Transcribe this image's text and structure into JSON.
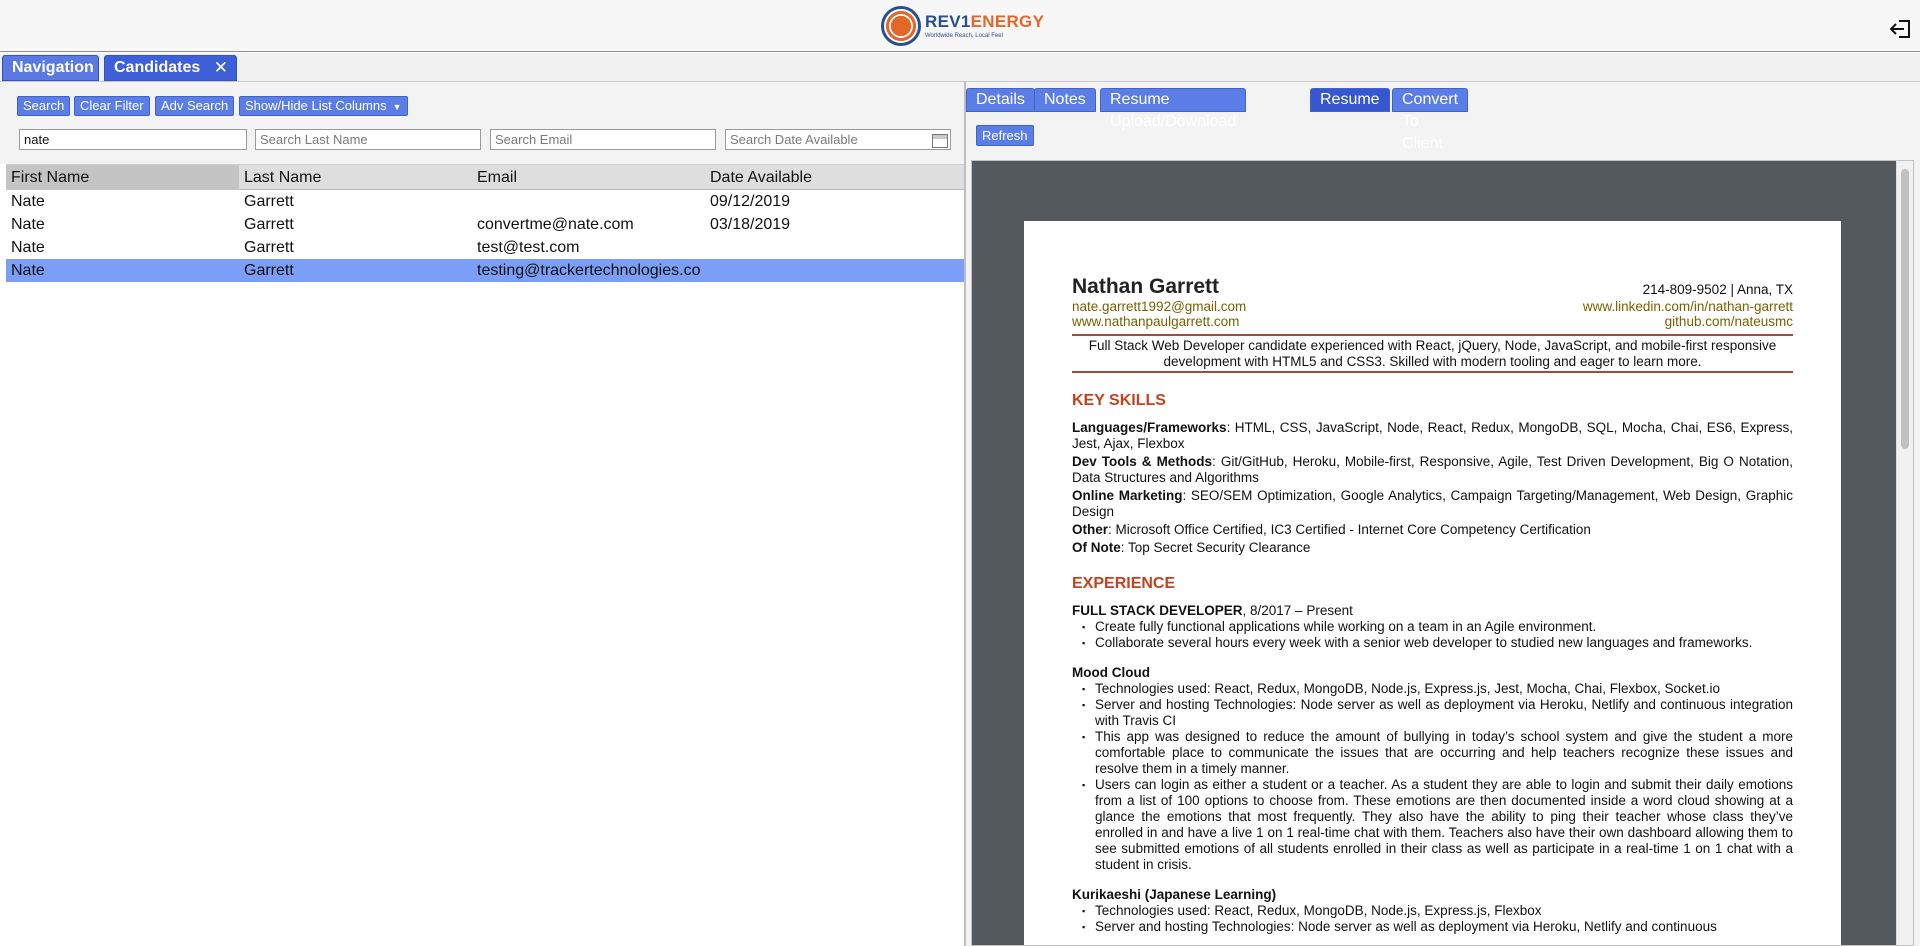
{
  "header": {
    "logo_word_a": "REV1",
    "logo_word_b": "ENERGY",
    "logo_tagline": "Worldwide Reach, Local Feel"
  },
  "main_tabs": [
    {
      "label": "Navigation"
    },
    {
      "label": "Candidates",
      "close": "✕"
    }
  ],
  "toolbar": {
    "search": "Search",
    "clear_filter": "Clear Filter",
    "adv_search": "Adv Search",
    "show_hide": "Show/Hide List Columns"
  },
  "filters": {
    "first_name_value": "nate",
    "last_name_placeholder": "Search Last Name",
    "email_placeholder": "Search Email",
    "date_placeholder": "Search Date Available"
  },
  "grid": {
    "columns": [
      "First Name",
      "Last Name",
      "Email",
      "Date Available"
    ],
    "rows": [
      {
        "first": "Nate",
        "last": "Garrett",
        "email": "",
        "date": "09/12/2019"
      },
      {
        "first": "Nate",
        "last": "Garrett",
        "email": "convertme@nate.com",
        "date": "03/18/2019"
      },
      {
        "first": "Nate",
        "last": "Garrett",
        "email": "test@test.com",
        "date": ""
      },
      {
        "first": "Nate",
        "last": "Garrett",
        "email": "testing@trackertechnologies.co",
        "date": "",
        "selected": true
      }
    ]
  },
  "right_tabs": [
    "Details",
    "Notes",
    "Resume Upload/Download",
    "Resume",
    "Convert To Client"
  ],
  "active_right_tab": "Resume",
  "refresh": "Refresh",
  "resume": {
    "name": "Nathan Garrett",
    "email": "nate.garrett1992@gmail.com",
    "website": "www.nathanpaulgarrett.com",
    "phone_location": "214-809-9502 | Anna, TX",
    "linkedin": "www.linkedin.com/in/nathan-garrett",
    "github": "github.com/nateusmc",
    "summary": "Full Stack Web Developer candidate experienced with React, jQuery, Node, JavaScript, and mobile-first responsive development with HTML5 and CSS3. Skilled with modern tooling and eager to learn more.",
    "key_skills_title": "KEY SKILLS",
    "skills": [
      {
        "label": "Languages/Frameworks",
        "text": ": HTML, CSS, JavaScript, Node, React, Redux, MongoDB, SQL, Mocha, Chai, ES6, Express, Jest, Ajax, Flexbox"
      },
      {
        "label": "Dev Tools & Methods",
        "text": ": Git/GitHub, Heroku, Mobile-first, Responsive, Agile, Test Driven Development, Big O Notation, Data Structures and Algorithms"
      },
      {
        "label": "Online Marketing",
        "text": ": SEO/SEM Optimization, Google Analytics, Campaign Targeting/Management, Web Design, Graphic Design"
      },
      {
        "label": "Other",
        "text": ": Microsoft Office Certified, IC3 Certified - Internet Core Competency Certification"
      },
      {
        "label": "Of Note",
        "text": ": Top Secret Security Clearance"
      }
    ],
    "experience_title": "EXPERIENCE",
    "job_title": "FULL STACK DEVELOPER",
    "job_dates": ", 8/2017 – Present",
    "job_bullets": [
      "Create fully functional applications while working on a team in an Agile environment.",
      "Collaborate several hours every week with a senior web developer to studied new languages and frameworks."
    ],
    "project1_title": "Mood Cloud",
    "project1_bullets": [
      "Technologies used: React, Redux, MongoDB, Node.js, Express.js, Jest, Mocha, Chai, Flexbox, Socket.io",
      "Server and hosting Technologies: Node server as well as deployment via Heroku, Netlify and continuous integration with Travis CI",
      "This app was designed to reduce the amount of bullying in today’s school system and give the student a more comfortable place to communicate the issues that are occurring and help teachers recognize these issues and resolve them in a timely manner.",
      "Users can login as either a student or a teacher. As a student they are able to login and submit their daily emotions from a list of 100 options to choose from. These emotions are then documented inside a word cloud showing at a glance the emotions that most frequently. They also have the ability to ping their teacher whose class they’ve enrolled in and have a live 1 on 1 real-time chat with them. Teachers also have their own dashboard allowing them to see submitted emotions of all students enrolled in their class as well as participate in a real-time 1 on 1 chat with a student in crisis."
    ],
    "project2_title": "Kurikaeshi (Japanese Learning)",
    "project2_bullets": [
      "Technologies used: React, Redux, MongoDB, Node.js, Express.js, Flexbox",
      "Server and hosting Technologies: Node server as well as deployment via Heroku, Netlify and continuous"
    ]
  }
}
